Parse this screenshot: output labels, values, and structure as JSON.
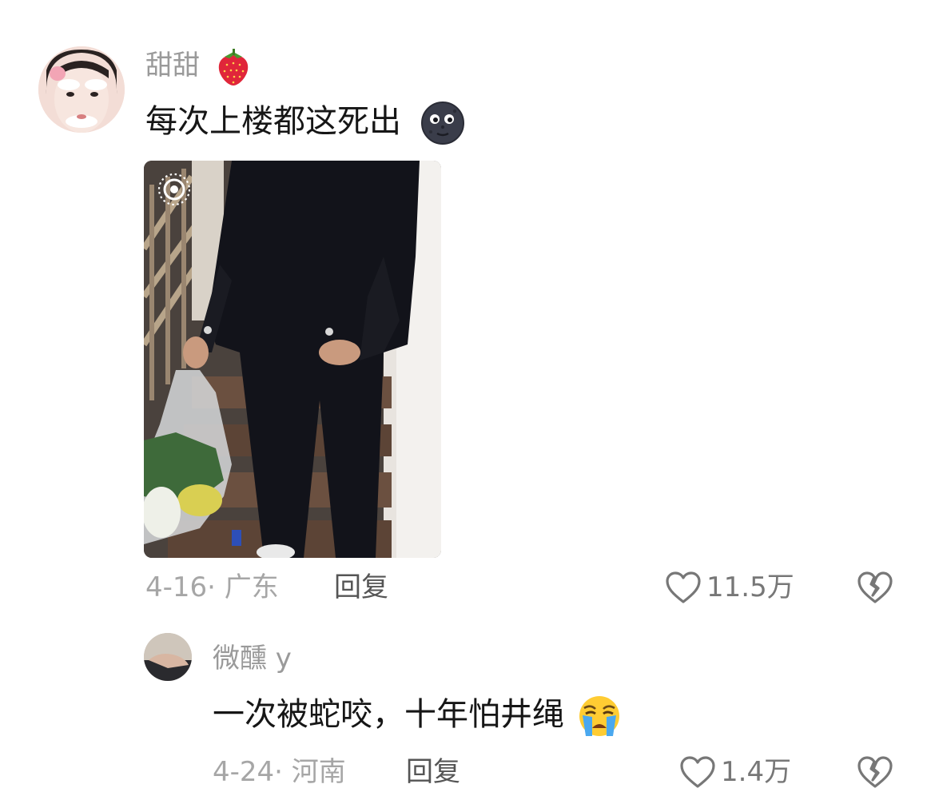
{
  "comment": {
    "username": "甜甜",
    "username_emoji": "strawberry-icon",
    "text": "每次上楼都这死出",
    "text_emoji": "dark-moon-face-icon",
    "photo_badge": "live-photo-icon",
    "date": "4-16",
    "location": "广东",
    "reply_label": "回复",
    "likes": "11.5万"
  },
  "reply": {
    "username": "微醺 y",
    "text": "一次被蛇咬，十年怕井绳",
    "text_emoji": "crying-face-icon",
    "date": "4-24",
    "location": "河南",
    "reply_label": "回复",
    "likes": "1.4万"
  },
  "colors": {
    "username": "#9a9a9a",
    "text": "#161616",
    "meta": "#a6a6a6",
    "icon": "#777777"
  }
}
